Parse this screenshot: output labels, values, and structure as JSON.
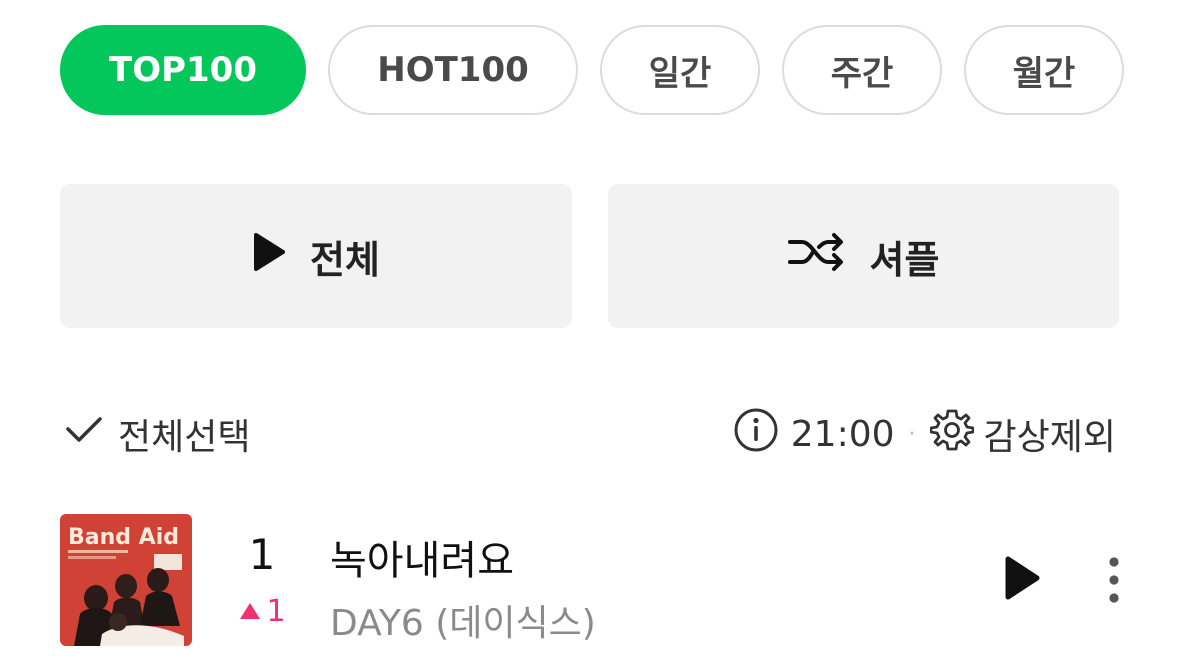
{
  "tabs": [
    {
      "label": "TOP100",
      "active": true
    },
    {
      "label": "HOT100",
      "active": false
    },
    {
      "label": "일간",
      "active": false
    },
    {
      "label": "주간",
      "active": false
    },
    {
      "label": "월간",
      "active": false
    }
  ],
  "actions": {
    "play_all_label": "전체",
    "shuffle_label": "셔플"
  },
  "toolbar": {
    "select_all_label": "전체선택",
    "time": "21:00",
    "separator": "·",
    "exclude_label": "감상제외"
  },
  "chart": [
    {
      "rank": "1",
      "change": "1",
      "change_direction": "up",
      "title": "녹아내려요",
      "artist": "DAY6 (데이식스)",
      "album_text": "Band Aid"
    }
  ],
  "colors": {
    "accent": "#03c75a",
    "rank_up": "#f0306f",
    "album_bg": "#d8483a"
  },
  "icons": {
    "play": "play-icon",
    "shuffle": "shuffle-icon",
    "check": "check-icon",
    "info": "info-icon",
    "gear": "gear-icon",
    "more": "more-vertical-icon"
  }
}
